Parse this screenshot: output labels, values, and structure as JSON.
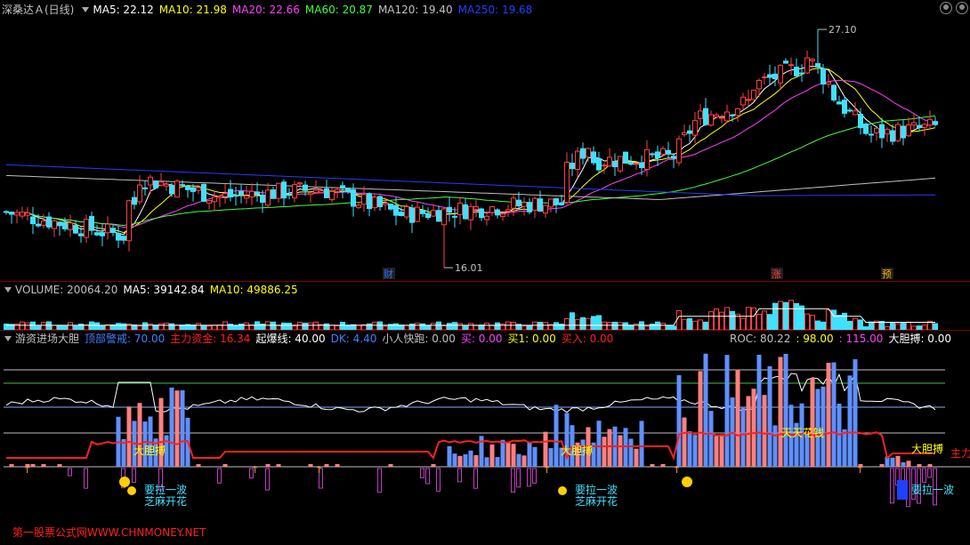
{
  "price_pane": {
    "title": "深桑达Ａ(日线)",
    "ma": [
      {
        "label": "MA5: 22.12",
        "color": "#ffffff"
      },
      {
        "label": "MA10: 21.98",
        "color": "#ffff00"
      },
      {
        "label": "MA20: 22.66",
        "color": "#ff40ff"
      },
      {
        "label": "MA60: 20.87",
        "color": "#40ff40"
      },
      {
        "label": "MA120: 19.40",
        "color": "#c0c0c0"
      },
      {
        "label": "MA250: 19.68",
        "color": "#2040ff"
      }
    ],
    "high_label": "27.10",
    "low_label": "16.01",
    "badges": [
      {
        "text": "财",
        "color": "#3070ff"
      },
      {
        "text": "涨",
        "color": "#ff4040"
      },
      {
        "text": "预",
        "color": "#ffb000"
      }
    ]
  },
  "volume_pane": {
    "items": [
      {
        "label": "VOLUME: 20064.20",
        "color": "#c0c0c0"
      },
      {
        "label": "MA5: 39142.84",
        "color": "#ffffff"
      },
      {
        "label": "MA10: 49886.25",
        "color": "#ffff00"
      }
    ]
  },
  "indicator_pane": {
    "items": [
      {
        "label": "游资进场大胆",
        "color": "#c0c0c0"
      },
      {
        "label": "顶部警戒: 70.00",
        "color": "#4080ff"
      },
      {
        "label": "主力资金: 16.34",
        "color": "#ff2020"
      },
      {
        "label": "起爆线: 40.00",
        "color": "#ffffff"
      },
      {
        "label": "DK: 4.40",
        "color": "#4080ff"
      },
      {
        "label": "小人快跑: 0.00",
        "color": "#c0c0c0"
      },
      {
        "label": "买: 0.00",
        "color": "#ff40ff"
      },
      {
        "label": "买1: 0.00",
        "color": "#ffff00"
      },
      {
        "label": "买入: 0.00",
        "color": "#ff2020"
      }
    ],
    "items_right": [
      {
        "label": "ROC: 80.22",
        "color": "#c0c0c0"
      },
      {
        "label": ": 98.00",
        "color": "#ffff00"
      },
      {
        "label": ": 115.00",
        "color": "#ff40ff"
      },
      {
        "label": "大胆搏: 0.00",
        "color": "#ffffff"
      }
    ],
    "signal_texts": {
      "bold": "大胆搏",
      "tiantian": "天天花钱",
      "wave": "要拉一波",
      "sesame": "芝麻开花",
      "zhuli": "主力"
    }
  },
  "watermark": "第一股票公式网WWW.CHNMONEY.NET",
  "chart_data": [
    {
      "type": "candlestick",
      "title": "深桑达Ａ(日线)",
      "series_names": [
        "MA5",
        "MA10",
        "MA20",
        "MA60",
        "MA120",
        "MA250"
      ],
      "max_price": 27.1,
      "min_price": 16.01,
      "latest_ma": {
        "MA5": 22.12,
        "MA10": 21.98,
        "MA20": 22.66,
        "MA60": 20.87,
        "MA120": 19.4,
        "MA250": 19.68
      }
    },
    {
      "type": "bar",
      "title": "VOLUME",
      "latest": {
        "VOLUME": 20064.2,
        "MA5": 39142.84,
        "MA10": 49886.25
      }
    },
    {
      "type": "bar",
      "title": "游资进场大胆",
      "reference_lines": [
        70.0,
        40.0
      ],
      "latest": {
        "主力资金": 16.34,
        "DK": 4.4,
        "ROC": 80.22
      }
    }
  ]
}
